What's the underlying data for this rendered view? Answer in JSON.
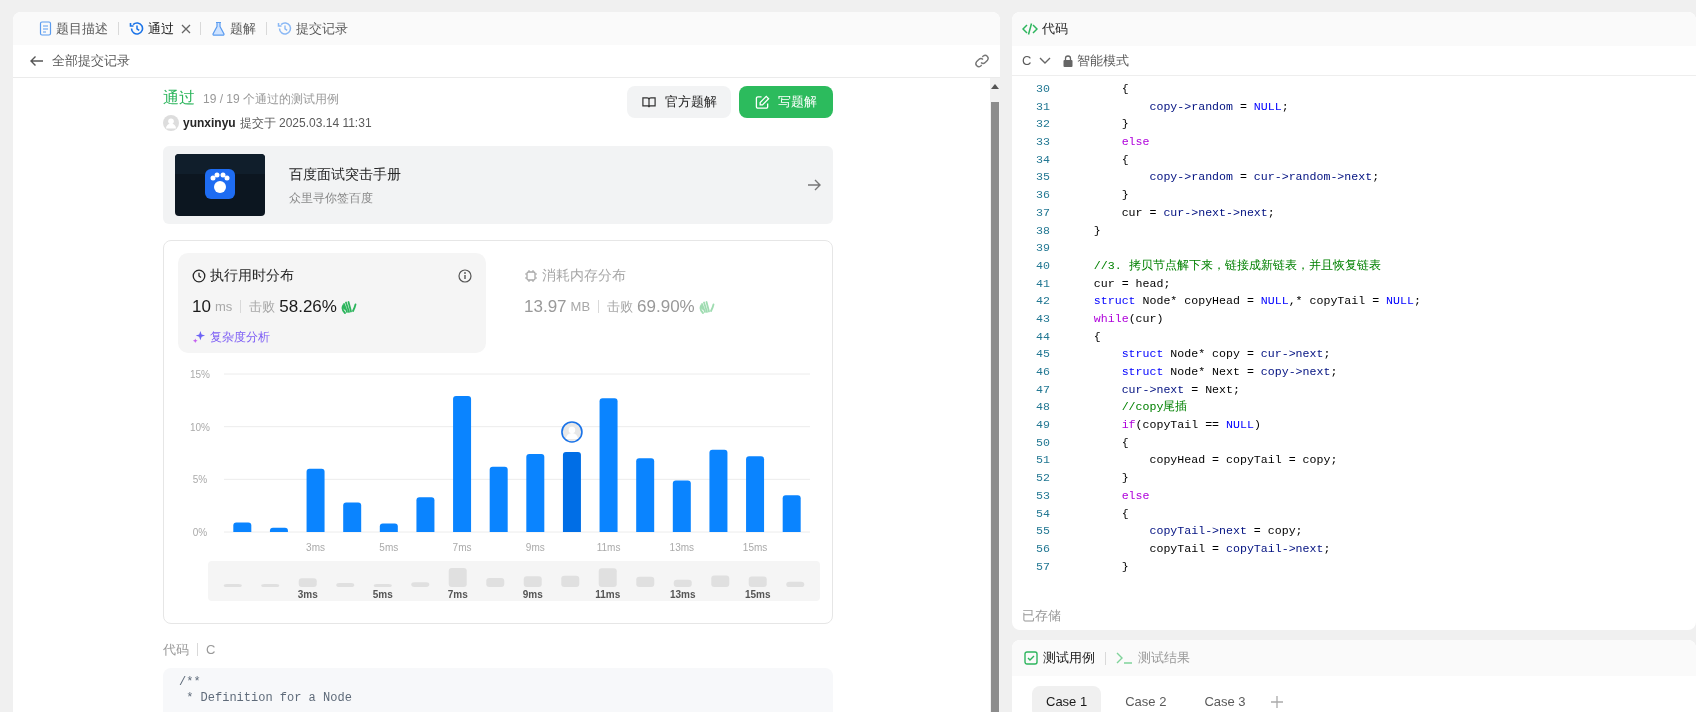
{
  "tabs": [
    {
      "label": "题目描述",
      "kind": "description",
      "selected": false,
      "closable": false
    },
    {
      "label": "通过",
      "kind": "submission",
      "selected": true,
      "closable": true
    },
    {
      "label": "题解",
      "kind": "solution",
      "selected": false,
      "closable": false
    },
    {
      "label": "提交记录",
      "kind": "history",
      "selected": false,
      "closable": false
    }
  ],
  "back_link": "全部提交记录",
  "result": {
    "status": "通过",
    "cases": "19 / 19 个通过的测试用例",
    "user": "yunxinyu",
    "submitted": "提交于 2025.03.14 11:31"
  },
  "actions": [
    {
      "label": "官方题解",
      "kind": "secondary"
    },
    {
      "label": "写题解",
      "kind": "primary"
    }
  ],
  "promo": {
    "title": "百度面试突击手册",
    "subtitle": "众里寻你签百度"
  },
  "stats": [
    {
      "title": "执行用时分布",
      "value": "10",
      "unit": "ms",
      "beats_label": "击败",
      "beats": "58.26%",
      "selected": true,
      "link": "复杂度分析"
    },
    {
      "title": "消耗内存分布",
      "value": "13.97",
      "unit": "MB",
      "beats_label": "击败",
      "beats": "69.90%",
      "selected": false
    }
  ],
  "chart_data": {
    "type": "bar",
    "x": [
      1,
      2,
      3,
      4,
      5,
      6,
      7,
      8,
      9,
      10,
      11,
      12,
      13,
      14,
      15,
      16
    ],
    "values": [
      0.9,
      0.4,
      6.0,
      2.8,
      0.8,
      3.3,
      12.9,
      6.2,
      7.4,
      7.6,
      12.7,
      7.0,
      4.9,
      7.8,
      7.2,
      3.5
    ],
    "xticks": [
      {
        "value": 3,
        "label": "3ms"
      },
      {
        "value": 5,
        "label": "5ms"
      },
      {
        "value": 7,
        "label": "7ms"
      },
      {
        "value": 9,
        "label": "9ms"
      },
      {
        "value": 11,
        "label": "11ms"
      },
      {
        "value": 13,
        "label": "13ms"
      },
      {
        "value": 15,
        "label": "15ms"
      }
    ],
    "yticks": [
      {
        "value": 0,
        "label": "0%"
      },
      {
        "value": 5,
        "label": "5%"
      },
      {
        "value": 10,
        "label": "10%"
      },
      {
        "value": 15,
        "label": "15%"
      }
    ],
    "xlim": [
      0.5,
      16.5
    ],
    "ylim": [
      0,
      15
    ]
  },
  "bars": [
    {
      "selected": false
    },
    {
      "selected": false
    },
    {
      "selected": false
    },
    {
      "selected": false
    },
    {
      "selected": false
    },
    {
      "selected": false
    },
    {
      "selected": false
    },
    {
      "selected": false
    },
    {
      "selected": false
    },
    {
      "selected": true
    },
    {
      "selected": false
    },
    {
      "selected": false
    },
    {
      "selected": false
    },
    {
      "selected": false
    },
    {
      "selected": false
    },
    {
      "selected": false
    }
  ],
  "overview_labels": [
    "3ms",
    "5ms",
    "7ms",
    "9ms",
    "11ms",
    "13ms",
    "15ms"
  ],
  "code_section": {
    "label": "代码",
    "language": "C",
    "lines": [
      "/**",
      " * Definition for a Node"
    ]
  },
  "editor": {
    "title": "代码",
    "language": "C",
    "mode": "智能模式",
    "status": "已存储",
    "lines": [
      {
        "number": "30",
        "tokens": [
          {
            "kind": "plain",
            "text": "        {"
          }
        ]
      },
      {
        "number": "31",
        "tokens": [
          {
            "kind": "member",
            "text": "            copy->random"
          },
          {
            "kind": "plain",
            "text": " = "
          },
          {
            "kind": "constant",
            "text": "NULL"
          },
          {
            "kind": "plain",
            "text": ";"
          }
        ]
      },
      {
        "number": "32",
        "tokens": [
          {
            "kind": "plain",
            "text": "        }"
          }
        ]
      },
      {
        "number": "33",
        "tokens": [
          {
            "kind": "control",
            "text": "        else"
          }
        ]
      },
      {
        "number": "34",
        "tokens": [
          {
            "kind": "plain",
            "text": "        {"
          }
        ]
      },
      {
        "number": "35",
        "tokens": [
          {
            "kind": "member",
            "text": "            copy->random"
          },
          {
            "kind": "plain",
            "text": " = "
          },
          {
            "kind": "member",
            "text": "cur->random->next"
          },
          {
            "kind": "plain",
            "text": ";"
          }
        ]
      },
      {
        "number": "36",
        "tokens": [
          {
            "kind": "plain",
            "text": "        }"
          }
        ]
      },
      {
        "number": "37",
        "tokens": [
          {
            "kind": "plain",
            "text": "        cur = "
          },
          {
            "kind": "member",
            "text": "cur->next->next"
          },
          {
            "kind": "plain",
            "text": ";"
          }
        ]
      },
      {
        "number": "38",
        "tokens": [
          {
            "kind": "plain",
            "text": "    }"
          }
        ]
      },
      {
        "number": "39"
      },
      {
        "number": "40",
        "tokens": [
          {
            "kind": "comment",
            "text": "    //3. 拷贝节点解下来，链接成新链表，并且恢复链表"
          }
        ]
      },
      {
        "number": "41",
        "tokens": [
          {
            "kind": "plain",
            "text": "    cur = head;"
          }
        ]
      },
      {
        "number": "42",
        "tokens": [
          {
            "kind": "keyword",
            "text": "    struct"
          },
          {
            "kind": "plain",
            "text": " Node* copyHead = "
          },
          {
            "kind": "constant",
            "text": "NULL"
          },
          {
            "kind": "plain",
            "text": ",* copyTail = "
          },
          {
            "kind": "constant",
            "text": "NULL"
          },
          {
            "kind": "plain",
            "text": ";"
          }
        ]
      },
      {
        "number": "43",
        "tokens": [
          {
            "kind": "control",
            "text": "    while"
          },
          {
            "kind": "plain",
            "text": "(cur)"
          }
        ]
      },
      {
        "number": "44",
        "tokens": [
          {
            "kind": "plain",
            "text": "    {"
          }
        ]
      },
      {
        "number": "45",
        "tokens": [
          {
            "kind": "keyword",
            "text": "        struct"
          },
          {
            "kind": "plain",
            "text": " Node* copy = "
          },
          {
            "kind": "member",
            "text": "cur->next"
          },
          {
            "kind": "plain",
            "text": ";"
          }
        ]
      },
      {
        "number": "46",
        "tokens": [
          {
            "kind": "keyword",
            "text": "        struct"
          },
          {
            "kind": "plain",
            "text": " Node* Next = "
          },
          {
            "kind": "member",
            "text": "copy->next"
          },
          {
            "kind": "plain",
            "text": ";"
          }
        ]
      },
      {
        "number": "47",
        "tokens": [
          {
            "kind": "member",
            "text": "        cur->next"
          },
          {
            "kind": "plain",
            "text": " = Next;"
          }
        ]
      },
      {
        "number": "48",
        "tokens": [
          {
            "kind": "comment",
            "text": "        //copy尾插"
          }
        ]
      },
      {
        "number": "49",
        "tokens": [
          {
            "kind": "control",
            "text": "        if"
          },
          {
            "kind": "plain",
            "text": "(copyTail == "
          },
          {
            "kind": "constant",
            "text": "NULL"
          },
          {
            "kind": "plain",
            "text": ")"
          }
        ]
      },
      {
        "number": "50",
        "tokens": [
          {
            "kind": "plain",
            "text": "        {"
          }
        ]
      },
      {
        "number": "51",
        "tokens": [
          {
            "kind": "plain",
            "text": "            copyHead = copyTail = copy;"
          }
        ]
      },
      {
        "number": "52",
        "tokens": [
          {
            "kind": "plain",
            "text": "        }"
          }
        ]
      },
      {
        "number": "53",
        "tokens": [
          {
            "kind": "control",
            "text": "        else"
          }
        ]
      },
      {
        "number": "54",
        "tokens": [
          {
            "kind": "plain",
            "text": "        {"
          }
        ]
      },
      {
        "number": "55",
        "tokens": [
          {
            "kind": "member",
            "text": "            copyTail->next"
          },
          {
            "kind": "plain",
            "text": " = copy;"
          }
        ]
      },
      {
        "number": "56",
        "tokens": [
          {
            "kind": "plain",
            "text": "            copyTail = "
          },
          {
            "kind": "member",
            "text": "copyTail->next"
          },
          {
            "kind": "plain",
            "text": ";"
          }
        ]
      },
      {
        "number": "57",
        "tokens": [
          {
            "kind": "plain",
            "text": "        }"
          }
        ]
      }
    ]
  },
  "test_panel": {
    "tabs": [
      {
        "label": "测试用例",
        "kind": "cases",
        "selected": true
      },
      {
        "label": "测试结果",
        "kind": "result",
        "selected": false
      }
    ],
    "cases": [
      {
        "label": "Case 1",
        "selected": true
      },
      {
        "label": "Case 2",
        "selected": false
      },
      {
        "label": "Case 3",
        "selected": false
      }
    ]
  }
}
